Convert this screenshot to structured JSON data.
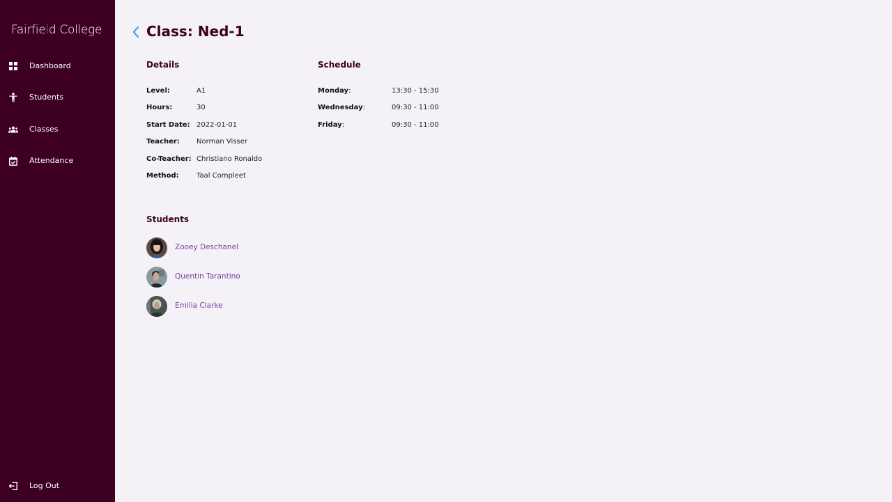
{
  "app": {
    "logo_left": "Fairfie",
    "logo_accent": "l",
    "logo_mid": "d",
    "logo_right": " College",
    "colors": {
      "sidebar": "#3d0022",
      "accent": "#3aa6e8",
      "link": "#7a3ea0"
    }
  },
  "sidebar": {
    "items": [
      {
        "label": "Dashboard",
        "icon": "dashboard-icon"
      },
      {
        "label": "Students",
        "icon": "person-icon"
      },
      {
        "label": "Classes",
        "icon": "group-icon"
      },
      {
        "label": "Attendance",
        "icon": "calendar-check-icon"
      }
    ],
    "logout": {
      "label": "Log Out",
      "icon": "logout-icon"
    }
  },
  "page": {
    "title": "Class: Ned-1",
    "back_icon": "chevron-left-icon"
  },
  "details": {
    "title": "Details",
    "rows": [
      {
        "label": "Level:",
        "value": "A1"
      },
      {
        "label": "Hours:",
        "value": "30"
      },
      {
        "label": "Start Date:",
        "value": "2022-01-01"
      },
      {
        "label": "Teacher:",
        "value": "Norman Visser"
      },
      {
        "label": "Co-Teacher:",
        "value": "Christiano Ronaldo"
      },
      {
        "label": "Method:",
        "value": "Taal Compleet"
      }
    ]
  },
  "schedule": {
    "title": "Schedule",
    "rows": [
      {
        "day": "Monday",
        "time": "13:30 - 15:30"
      },
      {
        "day": "Wednesday",
        "time": "09:30 - 11:00"
      },
      {
        "day": "Friday",
        "time": "09:30 - 11:00"
      }
    ]
  },
  "students": {
    "title": "Students",
    "items": [
      {
        "name": "Zooey Deschanel"
      },
      {
        "name": "Quentin Tarantino"
      },
      {
        "name": "Emilia Clarke"
      }
    ]
  }
}
